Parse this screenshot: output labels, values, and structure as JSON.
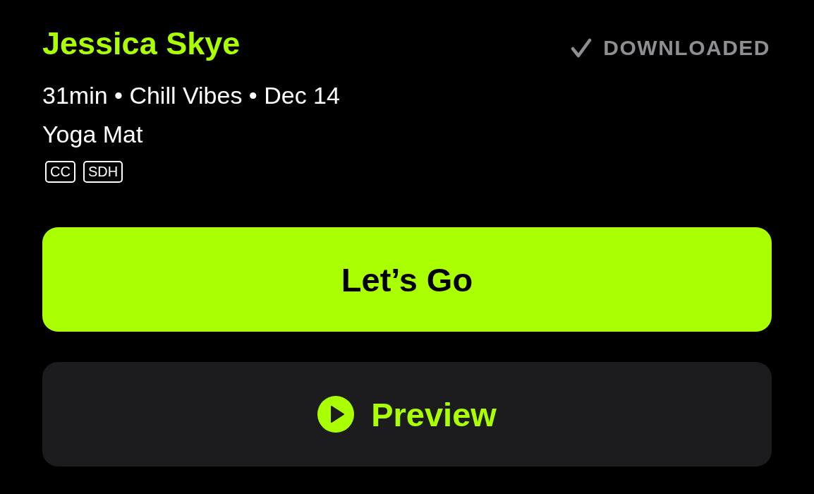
{
  "header": {
    "title": "Jessica Skye",
    "status": "DOWNLOADED"
  },
  "details": {
    "meta": "31min • Chill Vibes • Dec 14",
    "equipment": "Yoga Mat",
    "badges": [
      "CC",
      "SDH"
    ]
  },
  "buttons": [
    {
      "label": "Let’s Go",
      "kind": "primary"
    },
    {
      "label": "Preview",
      "kind": "preview"
    }
  ]
}
